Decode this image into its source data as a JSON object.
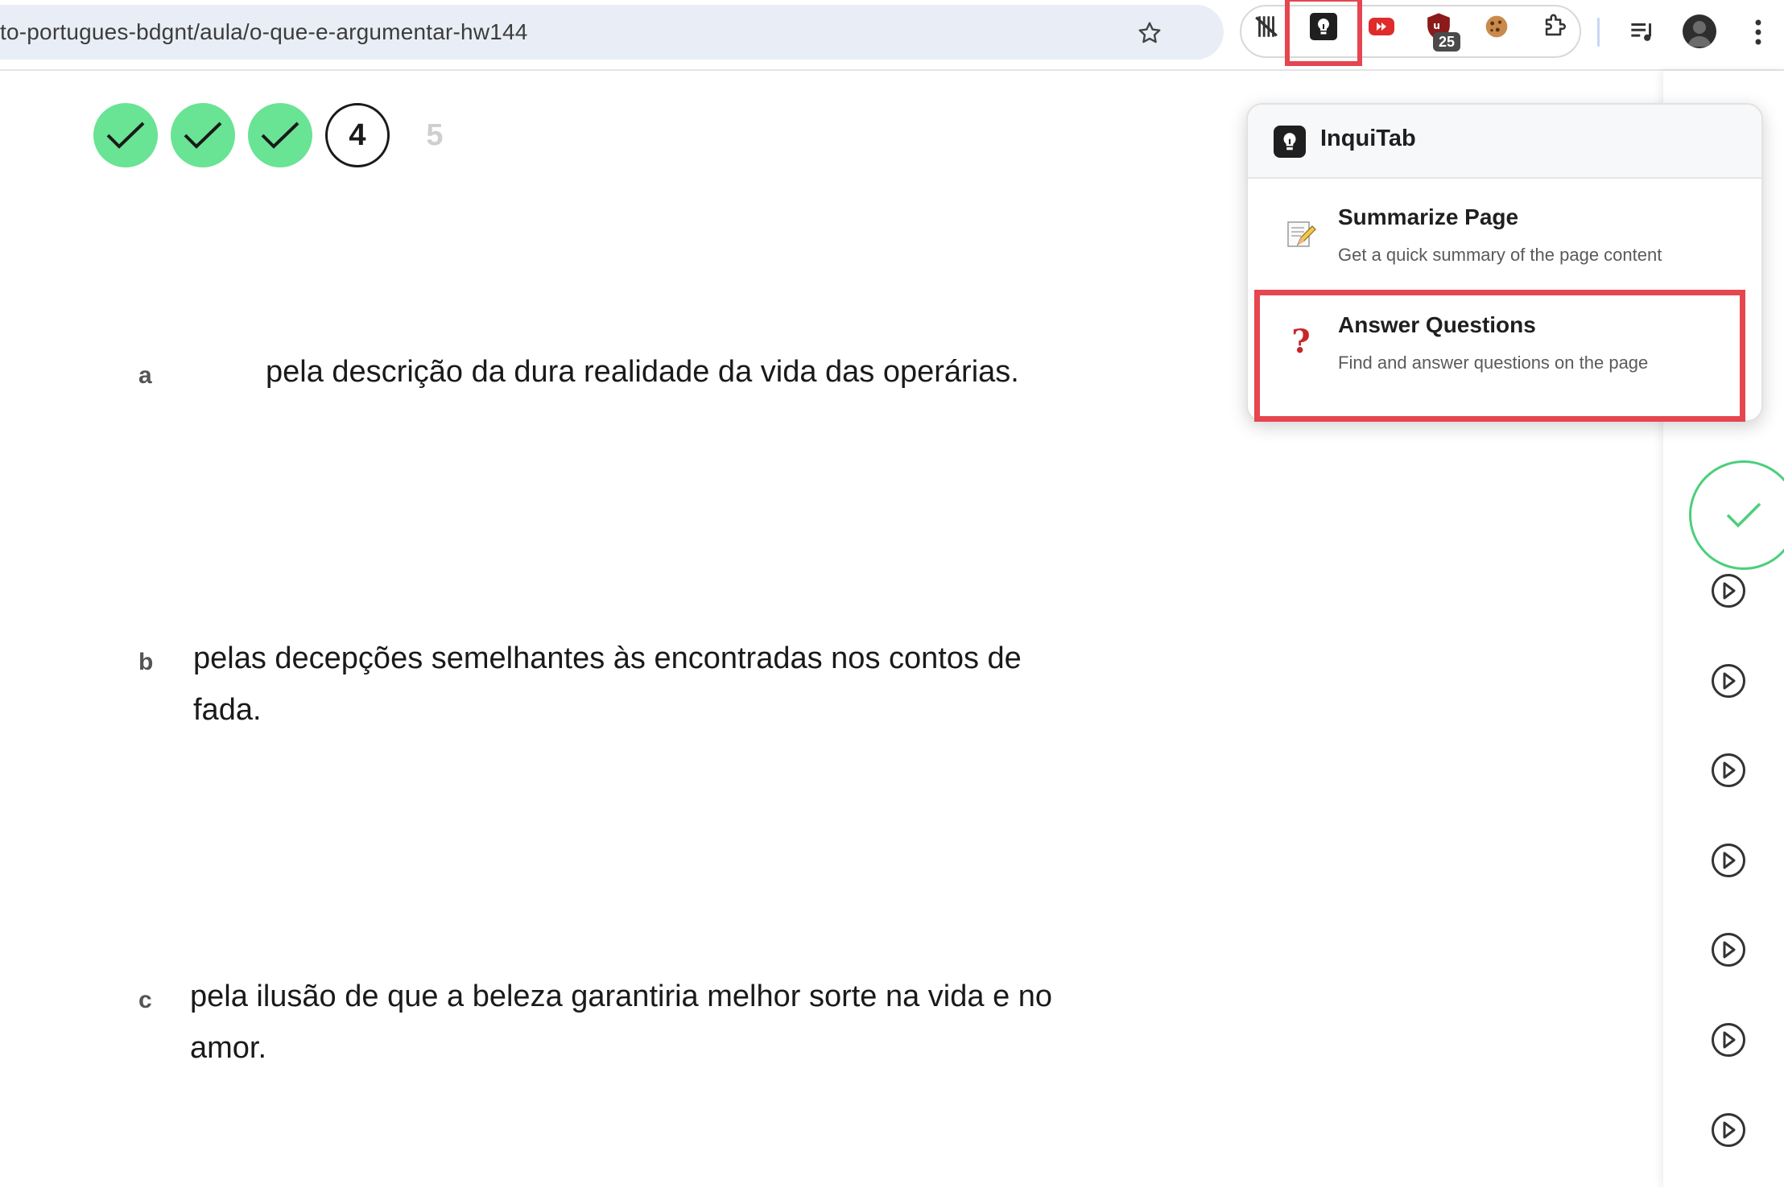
{
  "browser": {
    "url": "to-portugues-bdgnt/aula/o-que-e-argumentar-hw144",
    "extensions": [
      {
        "name": "no-ads-icon"
      },
      {
        "name": "inquitab-icon"
      },
      {
        "name": "youtube-icon"
      },
      {
        "name": "ublock-icon",
        "badge": "25"
      },
      {
        "name": "cookie-icon"
      },
      {
        "name": "puzzle-icon"
      }
    ]
  },
  "progress": {
    "steps": [
      {
        "label": "",
        "state": "done"
      },
      {
        "label": "",
        "state": "done"
      },
      {
        "label": "",
        "state": "done"
      },
      {
        "label": "4",
        "state": "current"
      },
      {
        "label": "5",
        "state": "future"
      }
    ]
  },
  "question": {
    "options": [
      {
        "letter": "a",
        "lines": [
          "pela descrição da dura realidade da vida das operárias."
        ]
      },
      {
        "letter": "b",
        "lines": [
          "pelas decepções semelhantes às encontradas nos contos de",
          "fada."
        ]
      },
      {
        "letter": "c",
        "lines": [
          "pela ilusão de que a beleza garantiria melhor sorte na vida e no",
          "amor."
        ]
      }
    ]
  },
  "popup": {
    "title": "InquiTab",
    "items": [
      {
        "icon": "memo-icon",
        "title": "Summarize Page",
        "description": "Get a quick summary of the page content"
      },
      {
        "icon": "question-mark-icon",
        "title": "Answer Questions",
        "description": "Find and answer questions on the page",
        "symbol": "?"
      }
    ]
  },
  "colors": {
    "done": "#69e394",
    "highlight": "#e5464f",
    "question_mark": "#c62828"
  }
}
